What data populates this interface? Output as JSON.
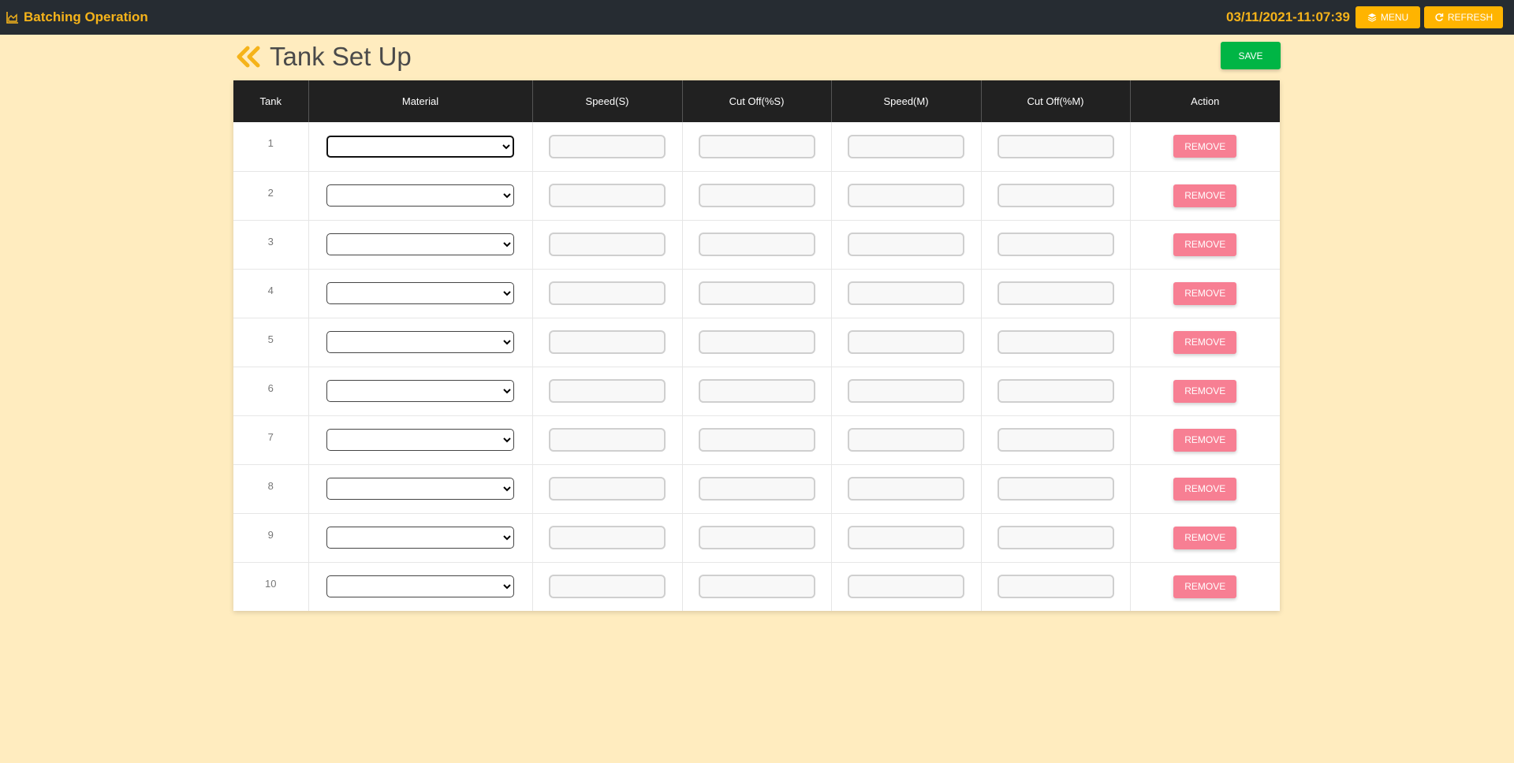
{
  "app": {
    "brand": "Batching Operation",
    "datetime": "03/11/2021-11:07:39",
    "menu_label": "MENU",
    "refresh_label": "REFRESH"
  },
  "page": {
    "title": "Tank Set Up",
    "save_label": "SAVE"
  },
  "table": {
    "columns": [
      "Tank",
      "Material",
      "Speed(S)",
      "Cut Off(%S)",
      "Speed(M)",
      "Cut Off(%M)",
      "Action"
    ],
    "remove_label": "REMOVE",
    "rows": [
      {
        "tank": "1",
        "material": "",
        "speed_s": "",
        "cutoff_s": "",
        "speed_m": "",
        "cutoff_m": ""
      },
      {
        "tank": "2",
        "material": "",
        "speed_s": "",
        "cutoff_s": "",
        "speed_m": "",
        "cutoff_m": ""
      },
      {
        "tank": "3",
        "material": "",
        "speed_s": "",
        "cutoff_s": "",
        "speed_m": "",
        "cutoff_m": ""
      },
      {
        "tank": "4",
        "material": "",
        "speed_s": "",
        "cutoff_s": "",
        "speed_m": "",
        "cutoff_m": ""
      },
      {
        "tank": "5",
        "material": "",
        "speed_s": "",
        "cutoff_s": "",
        "speed_m": "",
        "cutoff_m": ""
      },
      {
        "tank": "6",
        "material": "",
        "speed_s": "",
        "cutoff_s": "",
        "speed_m": "",
        "cutoff_m": ""
      },
      {
        "tank": "7",
        "material": "",
        "speed_s": "",
        "cutoff_s": "",
        "speed_m": "",
        "cutoff_m": ""
      },
      {
        "tank": "8",
        "material": "",
        "speed_s": "",
        "cutoff_s": "",
        "speed_m": "",
        "cutoff_m": ""
      },
      {
        "tank": "9",
        "material": "",
        "speed_s": "",
        "cutoff_s": "",
        "speed_m": "",
        "cutoff_m": ""
      },
      {
        "tank": "10",
        "material": "",
        "speed_s": "",
        "cutoff_s": "",
        "speed_m": "",
        "cutoff_m": ""
      }
    ]
  },
  "colors": {
    "topbar": "#262c32",
    "accent": "#f5b31a",
    "page_bg": "#ffecbf",
    "save": "#00b545",
    "remove": "#f77f93",
    "table_header": "#212121"
  },
  "icons": {
    "brand": "chart-area-icon",
    "menu": "layers-icon",
    "refresh": "refresh-icon",
    "back": "double-chevron-left-icon"
  }
}
